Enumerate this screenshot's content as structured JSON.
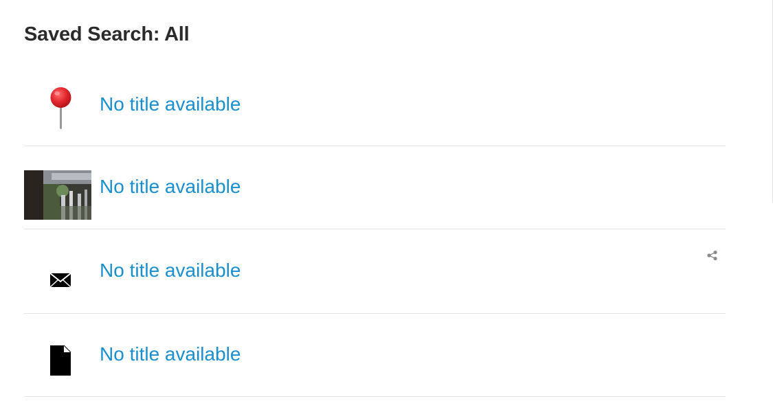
{
  "page": {
    "title": "Saved Search: All"
  },
  "results": [
    {
      "icon": "map-pin-icon",
      "title": "No title available"
    },
    {
      "icon": "photo-thumbnail",
      "title": "No title available"
    },
    {
      "icon": "envelope-icon",
      "title": "No title available",
      "share_icon": "share-icon"
    },
    {
      "icon": "document-icon",
      "title": "No title available"
    }
  ],
  "colors": {
    "link": "#1a8fd0",
    "title": "#2b2b2b",
    "divider": "#e3e3e3",
    "pin_head": "#e0262c"
  }
}
